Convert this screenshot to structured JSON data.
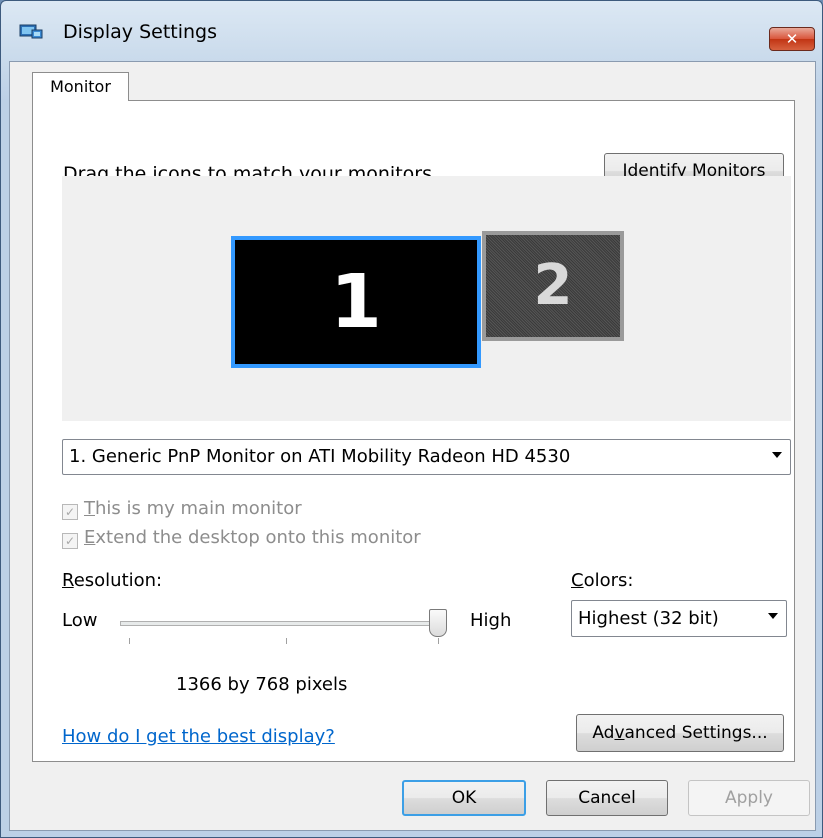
{
  "window": {
    "title": "Display Settings",
    "close_label": "✕",
    "accent": "#3399ff"
  },
  "tabs": [
    {
      "label": "Monitor",
      "active": true
    }
  ],
  "monitor_tab": {
    "instruction": "Drag the icons to match your monitors.",
    "identify_button": {
      "pre": "",
      "accel": "I",
      "post": "dentify Monitors"
    },
    "monitors": [
      {
        "number": "1",
        "selected": true
      },
      {
        "number": "2",
        "selected": false
      }
    ],
    "monitor_select": "1. Generic PnP Monitor on ATI Mobility Radeon HD 4530",
    "main_monitor": {
      "accel": "T",
      "rest": "his is my main monitor",
      "checked": true,
      "disabled": true
    },
    "extend_desktop": {
      "accel": "E",
      "rest": "xtend the desktop onto this monitor",
      "checked": true,
      "disabled": true
    },
    "resolution": {
      "label_accel": "R",
      "label_rest": "esolution:",
      "low": "Low",
      "high": "High",
      "level_fraction": 1.0,
      "value_text": "1366 by 768 pixels"
    },
    "colors": {
      "label_accel": "C",
      "label_rest": "olors:",
      "selected": "Highest (32 bit)"
    },
    "help_link": "How do I get the best display?",
    "advanced_button": {
      "pre": "Ad",
      "accel": "v",
      "post": "anced Settings..."
    }
  },
  "footer": {
    "ok": "OK",
    "cancel": "Cancel",
    "apply": "Apply"
  }
}
